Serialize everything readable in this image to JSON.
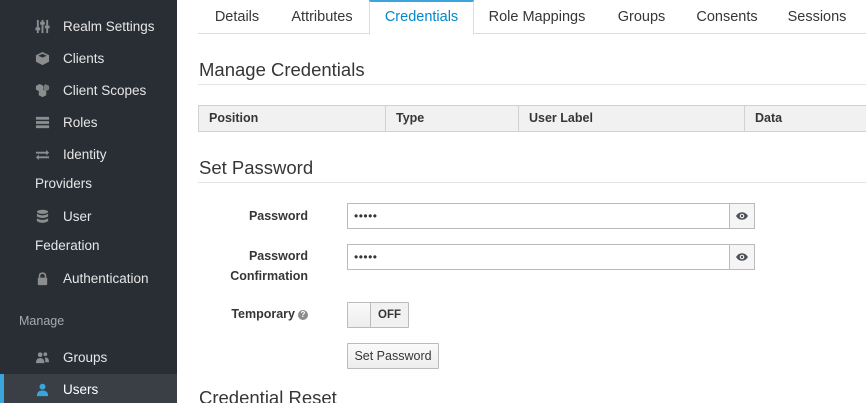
{
  "sidebar": {
    "items": [
      {
        "label": "Realm Settings",
        "icon": "sliders-icon"
      },
      {
        "label": "Clients",
        "icon": "cube-icon"
      },
      {
        "label": "Client Scopes",
        "icon": "cubes-icon"
      },
      {
        "label": "Roles",
        "icon": "list-icon"
      },
      {
        "label": "Identity",
        "cont": "Providers",
        "icon": "exchange-icon"
      },
      {
        "label": "User",
        "cont": "Federation",
        "icon": "database-icon"
      },
      {
        "label": "Authentication",
        "icon": "lock-icon"
      }
    ],
    "manage_heading": "Manage",
    "manage_items": [
      {
        "label": "Groups",
        "icon": "users-icon"
      },
      {
        "label": "Users",
        "icon": "user-icon",
        "active": true
      }
    ],
    "active_color": "#39a5dc"
  },
  "tabs": [
    "Details",
    "Attributes",
    "Credentials",
    "Role Mappings",
    "Groups",
    "Consents",
    "Sessions"
  ],
  "active_tab": "Credentials",
  "manage_credentials": {
    "title": "Manage Credentials",
    "columns": [
      "Position",
      "Type",
      "User Label",
      "Data"
    ]
  },
  "set_password": {
    "title": "Set Password",
    "password_label": "Password",
    "password_value": "•••••",
    "confirm_label_line1": "Password",
    "confirm_label_line2": "Confirmation",
    "confirm_value": "•••••",
    "temporary_label": "Temporary",
    "temporary_state": "OFF",
    "button_label": "Set Password"
  },
  "credential_reset": {
    "title": "Credential Reset"
  }
}
